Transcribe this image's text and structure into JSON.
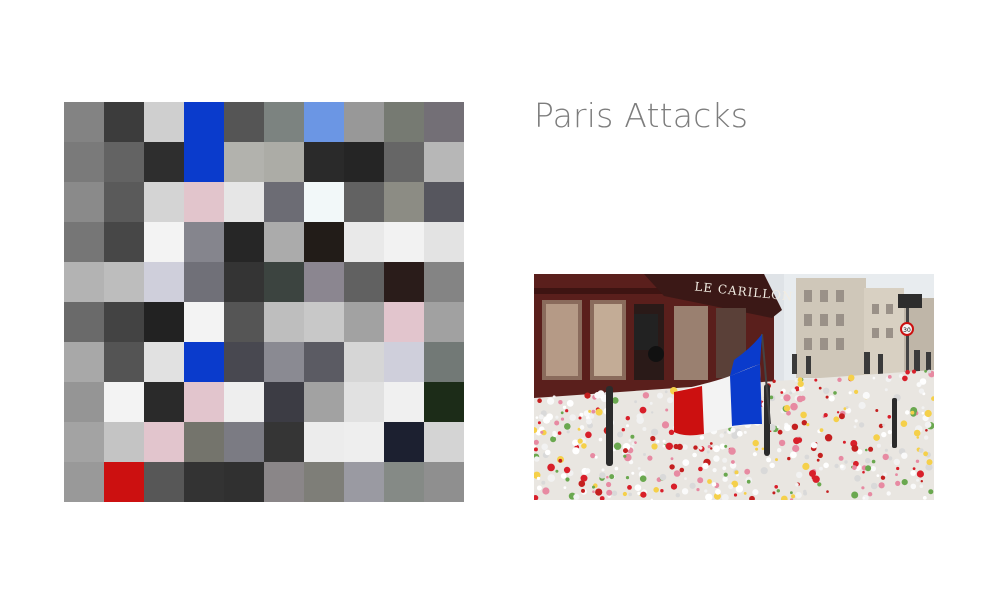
{
  "title": "Paris Attacks",
  "mosaic": {
    "colors": [
      [
        "#838383",
        "#3c3c3c",
        "#cfcfcf",
        "#0a3bcc",
        "#555555",
        "#7c8380",
        "#6b96e4",
        "#989898",
        "#767a72",
        "#736f76"
      ],
      [
        "#7a7a7a",
        "#636363",
        "#2e2e2e",
        "#0a3bcc",
        "#b2b2ad",
        "#acaca6",
        "#2a2a2a",
        "#252525",
        "#666666",
        "#b7b7b7"
      ],
      [
        "#8a8a8a",
        "#5a5a5a",
        "#d4d4d4",
        "#e2c5cc",
        "#e6e6e6",
        "#6c6c74",
        "#f2f8f9",
        "#626262",
        "#8c8c84",
        "#56565e"
      ],
      [
        "#767676",
        "#474747",
        "#f3f3f3",
        "#85858d",
        "#262626",
        "#ababab",
        "#221c18",
        "#e9e9e9",
        "#f2f2f2",
        "#e3e3e3"
      ],
      [
        "#b3b3b3",
        "#bdbdbd",
        "#cfcfdb",
        "#707078",
        "#343434",
        "#3c4440",
        "#8b8690",
        "#616161",
        "#2a1c1a",
        "#848484"
      ],
      [
        "#6a6a6a",
        "#434343",
        "#222222",
        "#f3f3f3",
        "#555555",
        "#bebebe",
        "#c8c8c8",
        "#a2a2a2",
        "#e2c5cd",
        "#a1a1a1"
      ],
      [
        "#a8a8a8",
        "#545454",
        "#e1e1e1",
        "#0a3bcc",
        "#484850",
        "#8a8a92",
        "#5b5b63",
        "#d6d6d6",
        "#cfcfdb",
        "#727976"
      ],
      [
        "#959595",
        "#f3f3f3",
        "#2a2a2a",
        "#e2c5cd",
        "#eeeeee",
        "#3c3c44",
        "#a2a2a2",
        "#e1e1e1",
        "#f0f0f0",
        "#1c2c18"
      ],
      [
        "#a3a3a3",
        "#c4c4c4",
        "#e2c5cd",
        "#74746c",
        "#7b7b83",
        "#353535",
        "#ececec",
        "#eeeeee",
        "#1c2030",
        "#d4d4d4"
      ],
      [
        "#999999",
        "#cc1010",
        "#575757",
        "#333333",
        "#303030",
        "#8a8688",
        "#7e7e78",
        "#9a9aa2",
        "#858a86",
        "#8f8f8f"
      ]
    ]
  },
  "photo": {
    "sign_text": "LE CARILLON",
    "speed_sign": "30",
    "flag_colors": [
      "#0a3bcc",
      "#f3f3f3",
      "#cc1010"
    ]
  }
}
